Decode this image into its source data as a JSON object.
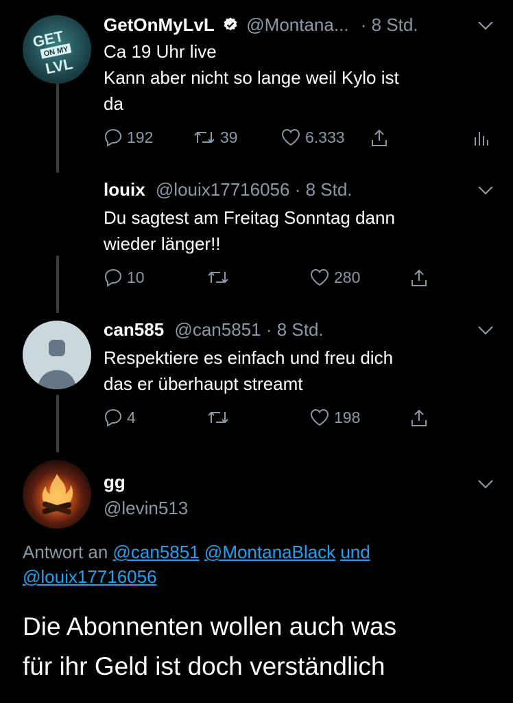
{
  "tweets": [
    {
      "display_name": "GetOnMyLvL",
      "handle": "@Montana...",
      "time": "· 8 Std.",
      "text_line1": "Ca 19 Uhr live",
      "text_line2": "Kann aber nicht so lange weil Kylo ist",
      "text_line3": "da",
      "replies": "192",
      "retweets": "39",
      "likes": "6.333",
      "avatar_text": "GET ON MY LVL"
    },
    {
      "display_name": "louix",
      "handle": "@louix17716056",
      "time": "· 8 Std.",
      "text_line1": "Du sagtest am Freitag Sonntag dann",
      "text_line2": "wieder länger!!",
      "replies": "10",
      "retweets": "",
      "likes": "280"
    },
    {
      "display_name": "can585",
      "handle": "@can5851",
      "time": "· 8 Std.",
      "text_line1": "Respektiere es einfach und freu dich",
      "text_line2": "das er überhaupt streamt",
      "replies": "4",
      "retweets": "",
      "likes": "198"
    }
  ],
  "main_tweet": {
    "display_name": "gg",
    "handle": "@levin513",
    "reply_prefix": "Antwort an",
    "reply_to_1": "@can5851",
    "reply_to_2": "@MontanaBlack",
    "reply_joiner": "und",
    "reply_to_3": "@louix17716056",
    "text_line1": "Die Abonnenten wollen auch was",
    "text_line2": "für ihr Geld ist doch verständlich"
  },
  "colors": {
    "background": "#000000",
    "muted": "#8899a6",
    "link": "#1da1f2"
  }
}
